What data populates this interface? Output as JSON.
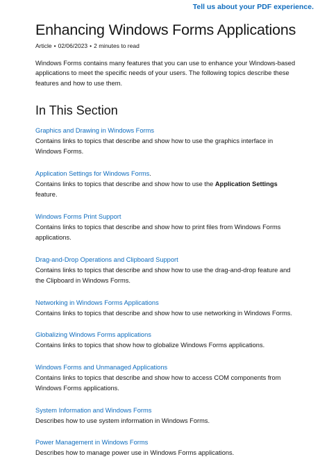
{
  "feedback_link": "Tell us about your PDF experience.",
  "article": {
    "title": "Enhancing Windows Forms Applications",
    "meta": {
      "type": "Article",
      "separator": "•",
      "date": "02/06/2023",
      "read_time": "2 minutes to read"
    },
    "intro": "Windows Forms contains many features that you can use to enhance your Windows-based applications to meet the specific needs of your users. The following topics describe these features and how to use them."
  },
  "section": {
    "heading": "In This Section",
    "topics": [
      {
        "link": "Graphics and Drawing in Windows Forms",
        "desc": "Contains links to topics that describe and show how to use the graphics interface in Windows Forms."
      },
      {
        "link": "Application Settings for Windows Forms",
        "link_suffix": ".",
        "desc_before": "Contains links to topics that describe and show how to use the ",
        "desc_bold": "Application Settings",
        "desc_after": " feature."
      },
      {
        "link": "Windows Forms Print Support",
        "desc": "Contains links to topics that describe and show how to print files from Windows Forms applications."
      },
      {
        "link": "Drag-and-Drop Operations and Clipboard Support",
        "desc": "Contains links to topics that describe and show how to use the drag-and-drop feature and the Clipboard in Windows Forms."
      },
      {
        "link": "Networking in Windows Forms Applications",
        "desc": "Contains links to topics that describe and show how to use networking in Windows Forms."
      },
      {
        "link": "Globalizing Windows Forms applications",
        "desc": "Contains links to topics that show how to globalize Windows Forms applications."
      },
      {
        "link": "Windows Forms and Unmanaged Applications",
        "desc": "Contains links to topics that describe and show how to access COM components from Windows Forms applications."
      },
      {
        "link": "System Information and Windows Forms",
        "desc": "Describes how to use system information in Windows Forms."
      },
      {
        "link": "Power Management in Windows Forms",
        "desc": "Describes how to manage power use in Windows Forms applications."
      }
    ]
  },
  "colors": {
    "link": "#0f6cbd",
    "text": "#161616"
  }
}
